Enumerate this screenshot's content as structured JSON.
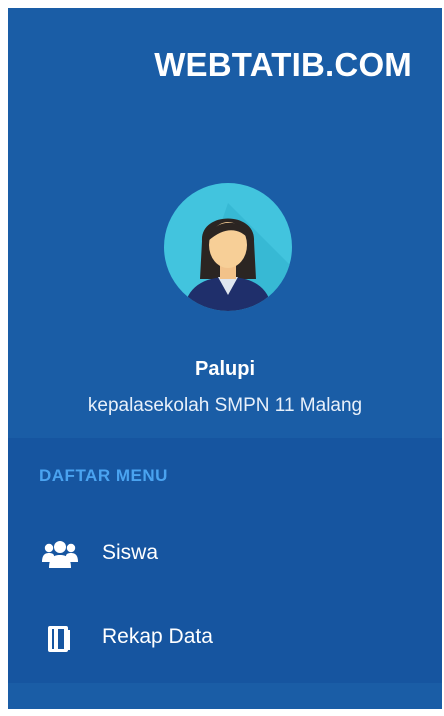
{
  "brand": {
    "title": "WEBTATIB.COM"
  },
  "user": {
    "name": "Palupi",
    "role": "kepalasekolah SMPN 11 Malang",
    "avatar_icon": "user-avatar-female"
  },
  "menu": {
    "header": "DAFTAR MENU",
    "items": [
      {
        "label": "Siswa",
        "icon": "users-icon"
      },
      {
        "label": "Rekap Data",
        "icon": "book-icon"
      }
    ]
  },
  "colors": {
    "sidebar_bg": "#1a5da6",
    "menu_bg": "#1655a0",
    "menu_header": "#4aa3f0",
    "avatar_bg": "#42c4de"
  }
}
